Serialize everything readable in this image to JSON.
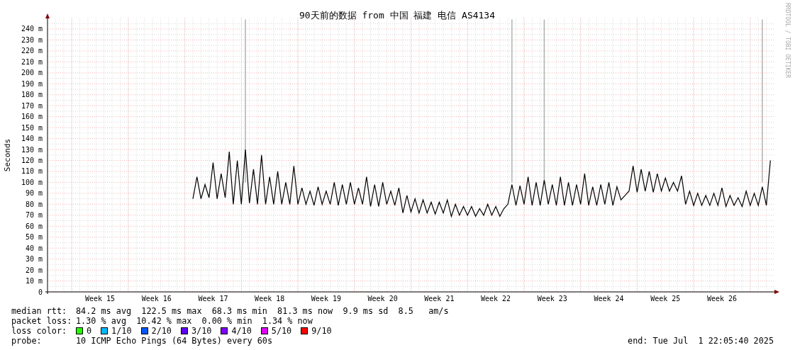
{
  "chart_data": {
    "type": "line",
    "grid": true,
    "title": "90天前的数据 from 中国 福建 电信 AS4134",
    "ylabel": "Seconds",
    "ylim": [
      0,
      250
    ],
    "categories": [
      null,
      null,
      null,
      null,
      null,
      null,
      null,
      null,
      null,
      null,
      null,
      null,
      null,
      "Week 15",
      null,
      null,
      null,
      null,
      null,
      null,
      null,
      null,
      null,
      null,
      null,
      null,
      null,
      "Week 16",
      null,
      null,
      null,
      null,
      null,
      null,
      null,
      null,
      null,
      null,
      null,
      null,
      null,
      "Week 17",
      null,
      null,
      null,
      null,
      null,
      null,
      null,
      null,
      null,
      null,
      null,
      null,
      null,
      "Week 18",
      null,
      null,
      null,
      null,
      null,
      null,
      null,
      null,
      null,
      null,
      null,
      null,
      null,
      "Week 19",
      null,
      null,
      null,
      null,
      null,
      null,
      null,
      null,
      null,
      null,
      null,
      null,
      null,
      "Week 20",
      null,
      null,
      null,
      null,
      null,
      null,
      null,
      null,
      null,
      null,
      null,
      null,
      null,
      "Week 21",
      null,
      null,
      null,
      null,
      null,
      null,
      null,
      null,
      null,
      null,
      null,
      null,
      null,
      "Week 22",
      null,
      null,
      null,
      null,
      null,
      null,
      null,
      null,
      null,
      null,
      null,
      null,
      null,
      "Week 23",
      null,
      null,
      null,
      null,
      null,
      null,
      null,
      null,
      null,
      null,
      null,
      null,
      null,
      "Week 24",
      null,
      null,
      null,
      null,
      null,
      null,
      null,
      null,
      null,
      null,
      null,
      null,
      null,
      "Week 25",
      null,
      null,
      null,
      null,
      null,
      null,
      null,
      null,
      null,
      null,
      null,
      null,
      null,
      "Week 26",
      null,
      null,
      null,
      null,
      null,
      null,
      null,
      null,
      null,
      null,
      null,
      null
    ],
    "yticks": [
      {
        "value": 0,
        "label": "0"
      },
      {
        "value": 10,
        "label": "10 m"
      },
      {
        "value": 20,
        "label": "20 m"
      },
      {
        "value": 30,
        "label": "30 m"
      },
      {
        "value": 40,
        "label": "40 m"
      },
      {
        "value": 50,
        "label": "50 m"
      },
      {
        "value": 60,
        "label": "60 m"
      },
      {
        "value": 70,
        "label": "70 m"
      },
      {
        "value": 80,
        "label": "80 m"
      },
      {
        "value": 90,
        "label": "90 m"
      },
      {
        "value": 100,
        "label": "100 m"
      },
      {
        "value": 110,
        "label": "110 m"
      },
      {
        "value": 120,
        "label": "120 m"
      },
      {
        "value": 130,
        "label": "130 m"
      },
      {
        "value": 140,
        "label": "140 m"
      },
      {
        "value": 150,
        "label": "150 m"
      },
      {
        "value": 160,
        "label": "160 m"
      },
      {
        "value": 170,
        "label": "170 m"
      },
      {
        "value": 180,
        "label": "180 m"
      },
      {
        "value": 190,
        "label": "190 m"
      },
      {
        "value": 200,
        "label": "200 m"
      },
      {
        "value": 210,
        "label": "210 m"
      },
      {
        "value": 220,
        "label": "220 m"
      },
      {
        "value": 230,
        "label": "230 m"
      },
      {
        "value": 240,
        "label": "240 m"
      }
    ],
    "series": [
      {
        "color": "#000000",
        "values": [
          null,
          null,
          null,
          null,
          null,
          null,
          null,
          null,
          null,
          null,
          null,
          null,
          null,
          null,
          null,
          null,
          null,
          null,
          null,
          null,
          null,
          null,
          null,
          null,
          null,
          null,
          null,
          null,
          null,
          null,
          null,
          null,
          null,
          null,
          null,
          null,
          85,
          105,
          85,
          98,
          86,
          118,
          85,
          108,
          86,
          128,
          80,
          120,
          80,
          130,
          81,
          112,
          80,
          125,
          80,
          105,
          80,
          110,
          80,
          100,
          80,
          115,
          80,
          95,
          80,
          92,
          79,
          96,
          80,
          92,
          80,
          100,
          79,
          98,
          80,
          100,
          80,
          95,
          80,
          105,
          78,
          98,
          78,
          100,
          80,
          92,
          79,
          95,
          72,
          88,
          73,
          85,
          72,
          84,
          72,
          82,
          71,
          82,
          72,
          84,
          69,
          80,
          70,
          78,
          70,
          78,
          69,
          76,
          70,
          80,
          70,
          78,
          69,
          76,
          80,
          98,
          79,
          97,
          80,
          105,
          79,
          100,
          79,
          102,
          80,
          98,
          79,
          105,
          79,
          100,
          79,
          98,
          80,
          108,
          79,
          96,
          79,
          98,
          80,
          100,
          79,
          96,
          84,
          88,
          92,
          115,
          91,
          112,
          92,
          110,
          91,
          108,
          92,
          104,
          92,
          100,
          92,
          106,
          80,
          92,
          79,
          90,
          79,
          88,
          79,
          90,
          79,
          95,
          78,
          88,
          79,
          86,
          78,
          92,
          79,
          90,
          79,
          96,
          79,
          120
        ]
      }
    ]
  },
  "signature": "RRDTOOL / TOBI OETIKER",
  "legend": [
    {
      "kind": "text",
      "label": "median rtt:",
      "value": "84.2 ms avg  122.5 ms max  68.3 ms min  81.3 ms now  9.9 ms sd  8.5   am/s"
    },
    {
      "kind": "text",
      "label": "packet loss:",
      "value": "1.30 % avg  10.42 % max  0.00 % min  1.34 % now"
    },
    {
      "kind": "colors",
      "label": "loss color:",
      "items": [
        {
          "label": "0",
          "color": "#26ff00"
        },
        {
          "label": "1/10",
          "color": "#00b8ff"
        },
        {
          "label": "2/10",
          "color": "#0059ff"
        },
        {
          "label": "3/10",
          "color": "#5e00ff"
        },
        {
          "label": "4/10",
          "color": "#7e00ff"
        },
        {
          "label": "5/10",
          "color": "#dd00ff"
        },
        {
          "label": "9/10",
          "color": "#ff0000"
        }
      ]
    },
    {
      "kind": "text",
      "label": "probe:",
      "value": "10 ICMP Echo Pings (64 Bytes) every 60s",
      "end": "end: Tue Jul  1 22:05:40 2025"
    }
  ]
}
